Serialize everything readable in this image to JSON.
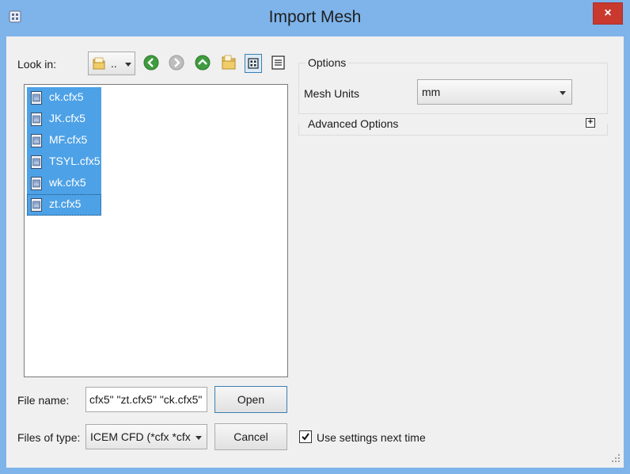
{
  "window": {
    "title": "Import Mesh",
    "close_label": "×"
  },
  "look_in": {
    "label": "Look in:",
    "value": ".."
  },
  "files": [
    {
      "name": "ck.cfx5"
    },
    {
      "name": "JK.cfx5"
    },
    {
      "name": "MF.cfx5"
    },
    {
      "name": "TSYL.cfx5"
    },
    {
      "name": "wk.cfx5"
    },
    {
      "name": "zt.cfx5"
    }
  ],
  "file_name": {
    "label": "File name:",
    "value": "cfx5\" \"zt.cfx5\" \"ck.cfx5\""
  },
  "file_type": {
    "label": "Files of type:",
    "value": "ICEM CFD (*cfx *cfx"
  },
  "buttons": {
    "open": "Open",
    "cancel": "Cancel"
  },
  "options": {
    "title": "Options",
    "mesh_units_label": "Mesh Units",
    "mesh_units_value": "mm",
    "advanced_label": "Advanced Options",
    "expand_symbol": "+"
  },
  "use_settings": {
    "label": "Use settings next time",
    "checked": true
  },
  "colors": {
    "titlebar": "#7eb4ea",
    "selection": "#4da1e6",
    "close": "#c9392e"
  },
  "icons": [
    "app-icon",
    "folder-icon",
    "back-icon",
    "forward-icon",
    "up-icon",
    "new-folder-icon",
    "list-view-icon",
    "detail-view-icon",
    "file-icon",
    "expand-icon",
    "checkmark-icon",
    "resize-grip-icon"
  ]
}
